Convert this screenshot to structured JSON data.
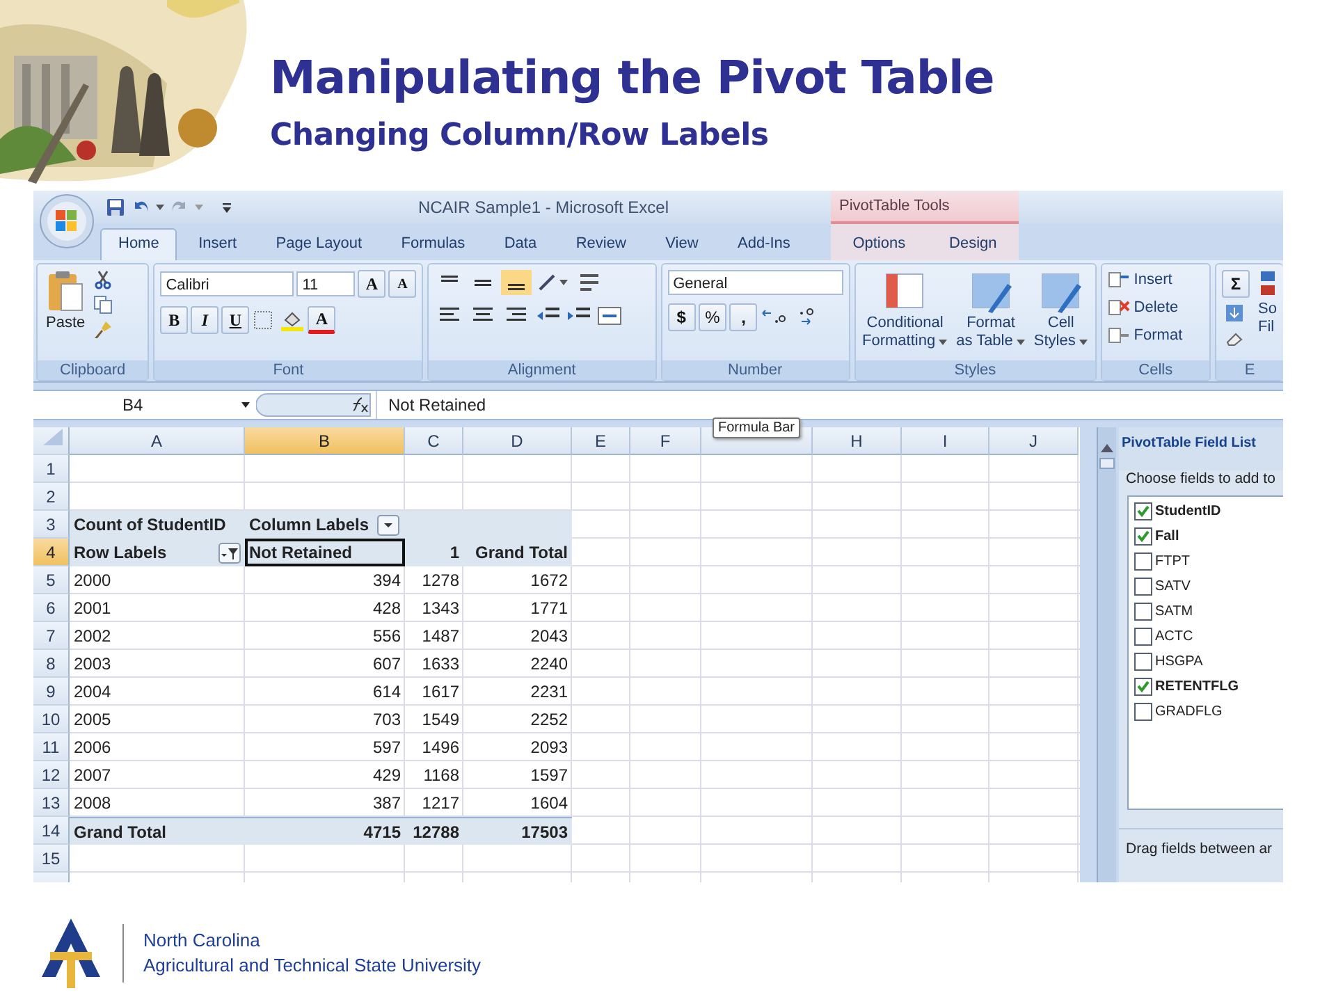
{
  "slide": {
    "title": "Manipulating the Pivot Table",
    "subtitle": "Changing Column/Row Labels",
    "footer_lines": [
      "North Carolina",
      "Agricultural and Technical State University"
    ]
  },
  "excel": {
    "window_title": "NCAIR Sample1 - Microsoft Excel",
    "contextual_group": "PivotTable Tools",
    "tabs": [
      {
        "label": "Home",
        "selected": true,
        "kind": "standard"
      },
      {
        "label": "Insert",
        "selected": false,
        "kind": "standard"
      },
      {
        "label": "Page Layout",
        "selected": false,
        "kind": "standard"
      },
      {
        "label": "Formulas",
        "selected": false,
        "kind": "standard"
      },
      {
        "label": "Data",
        "selected": false,
        "kind": "standard"
      },
      {
        "label": "Review",
        "selected": false,
        "kind": "standard"
      },
      {
        "label": "View",
        "selected": false,
        "kind": "standard"
      },
      {
        "label": "Add-Ins",
        "selected": false,
        "kind": "standard"
      },
      {
        "label": "Options",
        "selected": false,
        "kind": "contextual"
      },
      {
        "label": "Design",
        "selected": false,
        "kind": "contextual"
      }
    ],
    "ribbon": {
      "paste": "Paste",
      "font_name": "Calibri",
      "font_size": "11",
      "grow_font": "A",
      "shrink_font": "A",
      "bold": "B",
      "italic": "I",
      "underline": "U",
      "font_color": "A",
      "number_format": "General",
      "currency": "$",
      "percent": "%",
      "comma": ",",
      "styles": [
        {
          "line1": "Conditional",
          "line2": "Formatting"
        },
        {
          "line1": "Format",
          "line2": "as Table"
        },
        {
          "line1": "Cell",
          "line2": "Styles"
        }
      ],
      "cells": [
        "Insert",
        "Delete",
        "Format"
      ],
      "sum": "Σ",
      "sort_lines": [
        "So",
        "Fil"
      ],
      "groups": [
        "Clipboard",
        "Font",
        "Alignment",
        "Number",
        "Styles",
        "Cells",
        "E"
      ]
    },
    "name_box": "B4",
    "formula": "Not Retained",
    "tooltip": "Formula Bar",
    "columns": [
      {
        "label": "A",
        "selected": false
      },
      {
        "label": "B",
        "selected": true
      },
      {
        "label": "C",
        "selected": false
      },
      {
        "label": "D",
        "selected": false
      },
      {
        "label": "E",
        "selected": false
      },
      {
        "label": "F",
        "selected": false
      },
      {
        "selected": false
      },
      {
        "label": "H",
        "selected": false
      },
      {
        "label": "I",
        "selected": false
      },
      {
        "label": "J",
        "selected": false
      }
    ],
    "rows": [
      {
        "number": "1",
        "selected": false,
        "kind": "plain",
        "cells": []
      },
      {
        "number": "2",
        "selected": false,
        "kind": "plain",
        "cells": []
      },
      {
        "number": "3",
        "selected": false,
        "kind": "column_header",
        "cells": [
          "Count of StudentID",
          "Column Labels"
        ]
      },
      {
        "number": "4",
        "selected": true,
        "kind": "row_header",
        "cells": [
          "Row Labels",
          "Not Retained",
          "1",
          "Grand Total"
        ]
      },
      {
        "number": "5",
        "selected": false,
        "kind": "data",
        "cells": [
          "2000",
          "394",
          "1278",
          "1672"
        ]
      },
      {
        "number": "6",
        "selected": false,
        "kind": "data",
        "cells": [
          "2001",
          "428",
          "1343",
          "1771"
        ]
      },
      {
        "number": "7",
        "selected": false,
        "kind": "data",
        "cells": [
          "2002",
          "556",
          "1487",
          "2043"
        ]
      },
      {
        "number": "8",
        "selected": false,
        "kind": "data",
        "cells": [
          "2003",
          "607",
          "1633",
          "2240"
        ]
      },
      {
        "number": "9",
        "selected": false,
        "kind": "data",
        "cells": [
          "2004",
          "614",
          "1617",
          "2231"
        ]
      },
      {
        "number": "10",
        "selected": false,
        "kind": "data",
        "cells": [
          "2005",
          "703",
          "1549",
          "2252"
        ]
      },
      {
        "number": "11",
        "selected": false,
        "kind": "data",
        "cells": [
          "2006",
          "597",
          "1496",
          "2093"
        ]
      },
      {
        "number": "12",
        "selected": false,
        "kind": "data",
        "cells": [
          "2007",
          "429",
          "1168",
          "1597"
        ]
      },
      {
        "number": "13",
        "selected": false,
        "kind": "data",
        "cells": [
          "2008",
          "387",
          "1217",
          "1604"
        ]
      },
      {
        "number": "14",
        "selected": false,
        "kind": "total",
        "cells": [
          "Grand Total",
          "4715",
          "12788",
          "17503"
        ]
      },
      {
        "number": "15",
        "selected": false,
        "kind": "plain",
        "cells": []
      }
    ],
    "field_list": {
      "title": "PivotTable Field List",
      "prompt": "Choose fields to add to",
      "footer": "Drag fields between ar",
      "fields": [
        {
          "name": "StudentID",
          "checked": true
        },
        {
          "name": "Fall",
          "checked": true
        },
        {
          "name": "FTPT",
          "checked": false
        },
        {
          "name": "SATV",
          "checked": false
        },
        {
          "name": "SATM",
          "checked": false
        },
        {
          "name": "ACTC",
          "checked": false
        },
        {
          "name": "HSGPA",
          "checked": false
        },
        {
          "name": "RETENTFLG",
          "checked": true
        },
        {
          "name": "GRADFLG",
          "checked": false
        }
      ]
    }
  }
}
